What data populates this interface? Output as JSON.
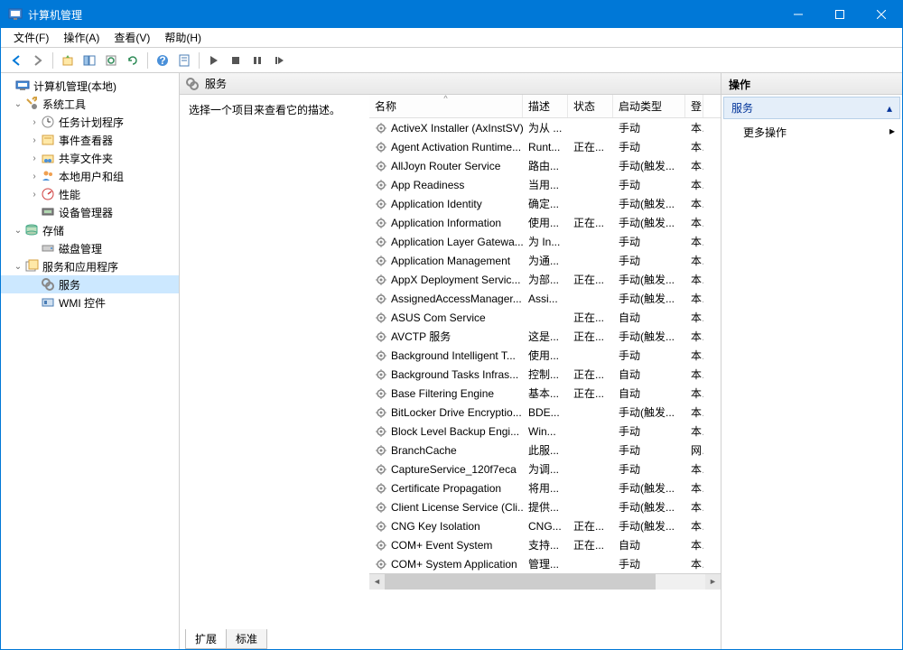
{
  "window": {
    "title": "计算机管理"
  },
  "menu": {
    "file": "文件(F)",
    "action": "操作(A)",
    "view": "查看(V)",
    "help": "帮助(H)"
  },
  "tree": {
    "root": "计算机管理(本地)",
    "systools": "系统工具",
    "scheduler": "任务计划程序",
    "eventviewer": "事件查看器",
    "shared": "共享文件夹",
    "users": "本地用户和组",
    "perf": "性能",
    "devmgr": "设备管理器",
    "storage": "存储",
    "diskmgmt": "磁盘管理",
    "svcapps": "服务和应用程序",
    "services": "服务",
    "wmi": "WMI 控件"
  },
  "mid": {
    "header": "服务",
    "detail_hint": "选择一个项目来查看它的描述。",
    "tabs": {
      "extended": "扩展",
      "standard": "标准"
    }
  },
  "columns": {
    "name": "名称",
    "desc": "描述",
    "status": "状态",
    "startup": "启动类型",
    "logon": "登"
  },
  "actions": {
    "header": "操作",
    "section": "服务",
    "more": "更多操作"
  },
  "services": [
    {
      "name": "ActiveX Installer (AxInstSV)",
      "desc": "为从 ...",
      "status": "",
      "startup": "手动",
      "logon": "本"
    },
    {
      "name": "Agent Activation Runtime...",
      "desc": "Runt...",
      "status": "正在...",
      "startup": "手动",
      "logon": "本"
    },
    {
      "name": "AllJoyn Router Service",
      "desc": "路由...",
      "status": "",
      "startup": "手动(触发...",
      "logon": "本"
    },
    {
      "name": "App Readiness",
      "desc": "当用...",
      "status": "",
      "startup": "手动",
      "logon": "本"
    },
    {
      "name": "Application Identity",
      "desc": "确定...",
      "status": "",
      "startup": "手动(触发...",
      "logon": "本"
    },
    {
      "name": "Application Information",
      "desc": "使用...",
      "status": "正在...",
      "startup": "手动(触发...",
      "logon": "本"
    },
    {
      "name": "Application Layer Gatewa...",
      "desc": "为 In...",
      "status": "",
      "startup": "手动",
      "logon": "本"
    },
    {
      "name": "Application Management",
      "desc": "为通...",
      "status": "",
      "startup": "手动",
      "logon": "本"
    },
    {
      "name": "AppX Deployment Servic...",
      "desc": "为部...",
      "status": "正在...",
      "startup": "手动(触发...",
      "logon": "本"
    },
    {
      "name": "AssignedAccessManager...",
      "desc": "Assi...",
      "status": "",
      "startup": "手动(触发...",
      "logon": "本"
    },
    {
      "name": "ASUS Com Service",
      "desc": "",
      "status": "正在...",
      "startup": "自动",
      "logon": "本"
    },
    {
      "name": "AVCTP 服务",
      "desc": "这是...",
      "status": "正在...",
      "startup": "手动(触发...",
      "logon": "本"
    },
    {
      "name": "Background Intelligent T...",
      "desc": "使用...",
      "status": "",
      "startup": "手动",
      "logon": "本"
    },
    {
      "name": "Background Tasks Infras...",
      "desc": "控制...",
      "status": "正在...",
      "startup": "自动",
      "logon": "本"
    },
    {
      "name": "Base Filtering Engine",
      "desc": "基本...",
      "status": "正在...",
      "startup": "自动",
      "logon": "本"
    },
    {
      "name": "BitLocker Drive Encryptio...",
      "desc": "BDE...",
      "status": "",
      "startup": "手动(触发...",
      "logon": "本"
    },
    {
      "name": "Block Level Backup Engi...",
      "desc": "Win...",
      "status": "",
      "startup": "手动",
      "logon": "本"
    },
    {
      "name": "BranchCache",
      "desc": "此服...",
      "status": "",
      "startup": "手动",
      "logon": "网"
    },
    {
      "name": "CaptureService_120f7eca",
      "desc": "为调...",
      "status": "",
      "startup": "手动",
      "logon": "本"
    },
    {
      "name": "Certificate Propagation",
      "desc": "将用...",
      "status": "",
      "startup": "手动(触发...",
      "logon": "本"
    },
    {
      "name": "Client License Service (Cli...",
      "desc": "提供...",
      "status": "",
      "startup": "手动(触发...",
      "logon": "本"
    },
    {
      "name": "CNG Key Isolation",
      "desc": "CNG...",
      "status": "正在...",
      "startup": "手动(触发...",
      "logon": "本"
    },
    {
      "name": "COM+ Event System",
      "desc": "支持...",
      "status": "正在...",
      "startup": "自动",
      "logon": "本"
    },
    {
      "name": "COM+ System Application",
      "desc": "管理...",
      "status": "",
      "startup": "手动",
      "logon": "本"
    }
  ]
}
